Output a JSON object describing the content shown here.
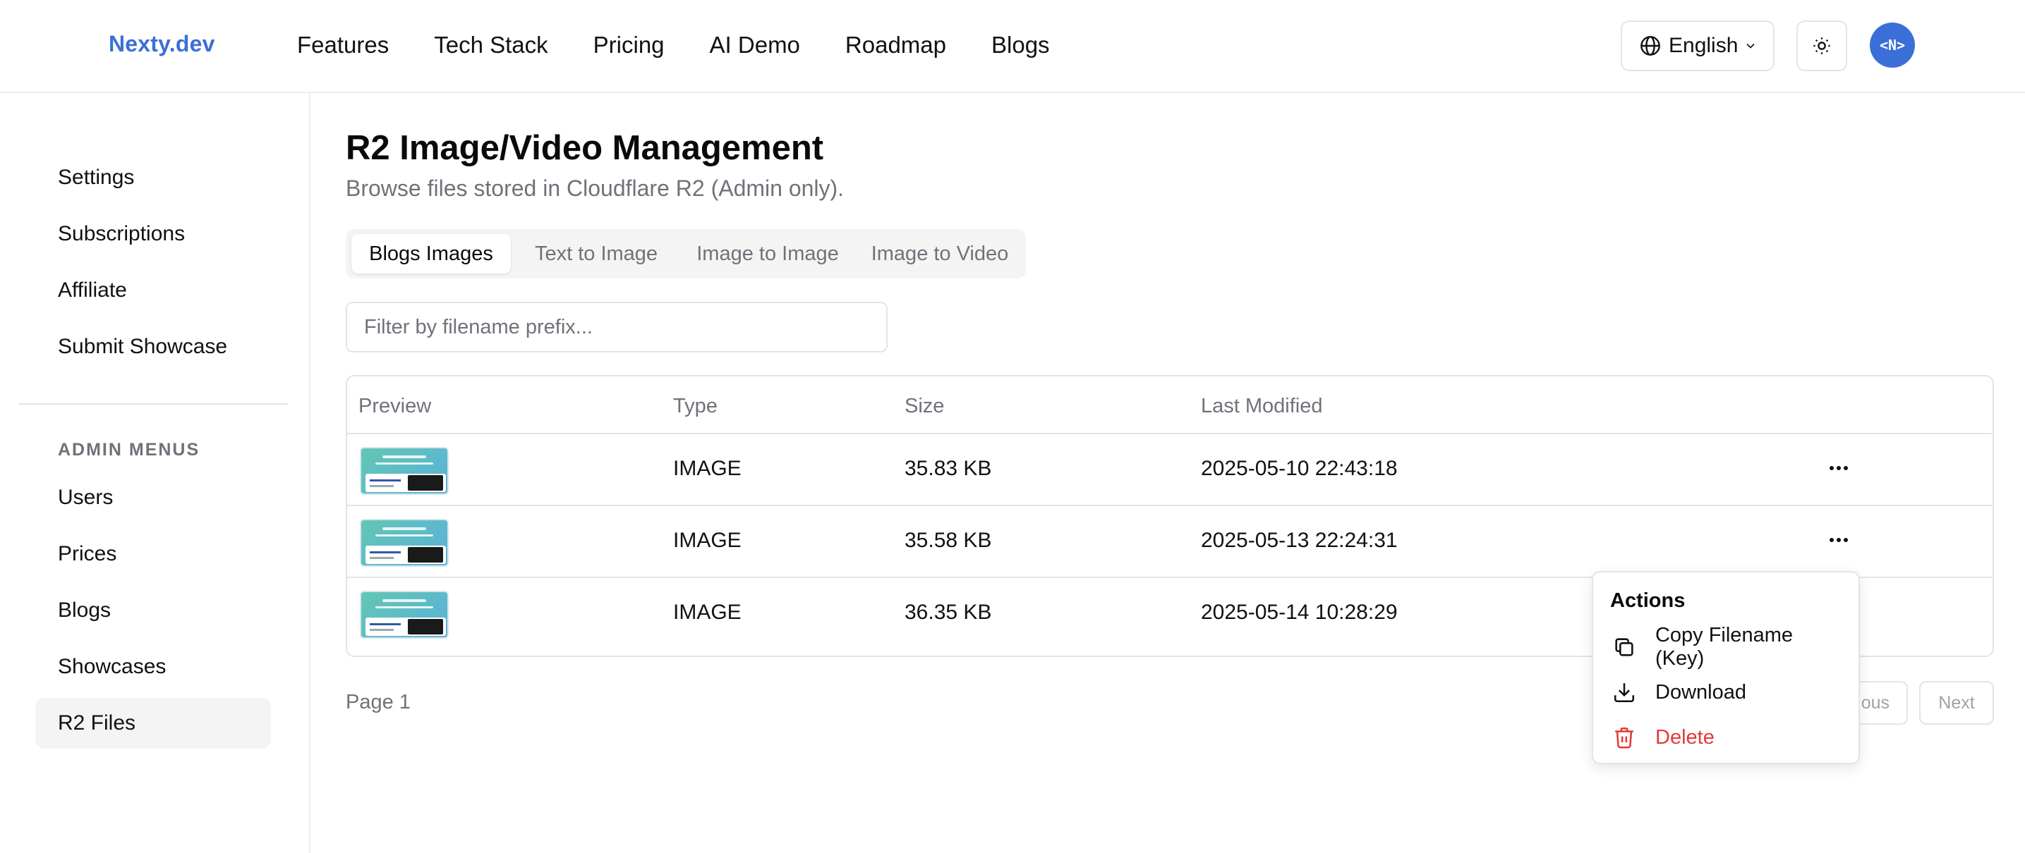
{
  "header": {
    "logo": "Nexty.dev",
    "nav": [
      "Features",
      "Tech Stack",
      "Pricing",
      "AI Demo",
      "Roadmap",
      "Blogs"
    ],
    "language": "English",
    "avatar_text": "<N>"
  },
  "sidebar": {
    "items": [
      "Settings",
      "Subscriptions",
      "Affiliate",
      "Submit Showcase"
    ],
    "admin_heading": "ADMIN MENUS",
    "admin_items": [
      "Users",
      "Prices",
      "Blogs",
      "Showcases",
      "R2 Files"
    ],
    "active_item": "R2 Files"
  },
  "main": {
    "title": "R2 Image/Video Management",
    "subtitle": "Browse files stored in Cloudflare R2 (Admin only).",
    "tabs": [
      "Blogs Images",
      "Text to Image",
      "Image to Image",
      "Image to Video"
    ],
    "active_tab": "Blogs Images",
    "filter_placeholder": "Filter by filename prefix...",
    "table": {
      "columns": [
        "Preview",
        "Type",
        "Size",
        "Last Modified"
      ],
      "rows": [
        {
          "type": "IMAGE",
          "size": "35.83 KB",
          "modified": "2025-05-10 22:43:18"
        },
        {
          "type": "IMAGE",
          "size": "35.58 KB",
          "modified": "2025-05-13 22:24:31"
        },
        {
          "type": "IMAGE",
          "size": "36.35 KB",
          "modified": "2025-05-14 10:28:29"
        }
      ]
    },
    "page_label": "Page 1",
    "previous_label": "ous",
    "next_label": "Next"
  },
  "actions_menu": {
    "title": "Actions",
    "items": [
      "Copy Filename (Key)",
      "Download",
      "Delete"
    ]
  },
  "colors": {
    "accent": "#3b6fd8",
    "danger": "#e53935",
    "muted_text": "#71717a",
    "border": "#e4e4e7"
  }
}
